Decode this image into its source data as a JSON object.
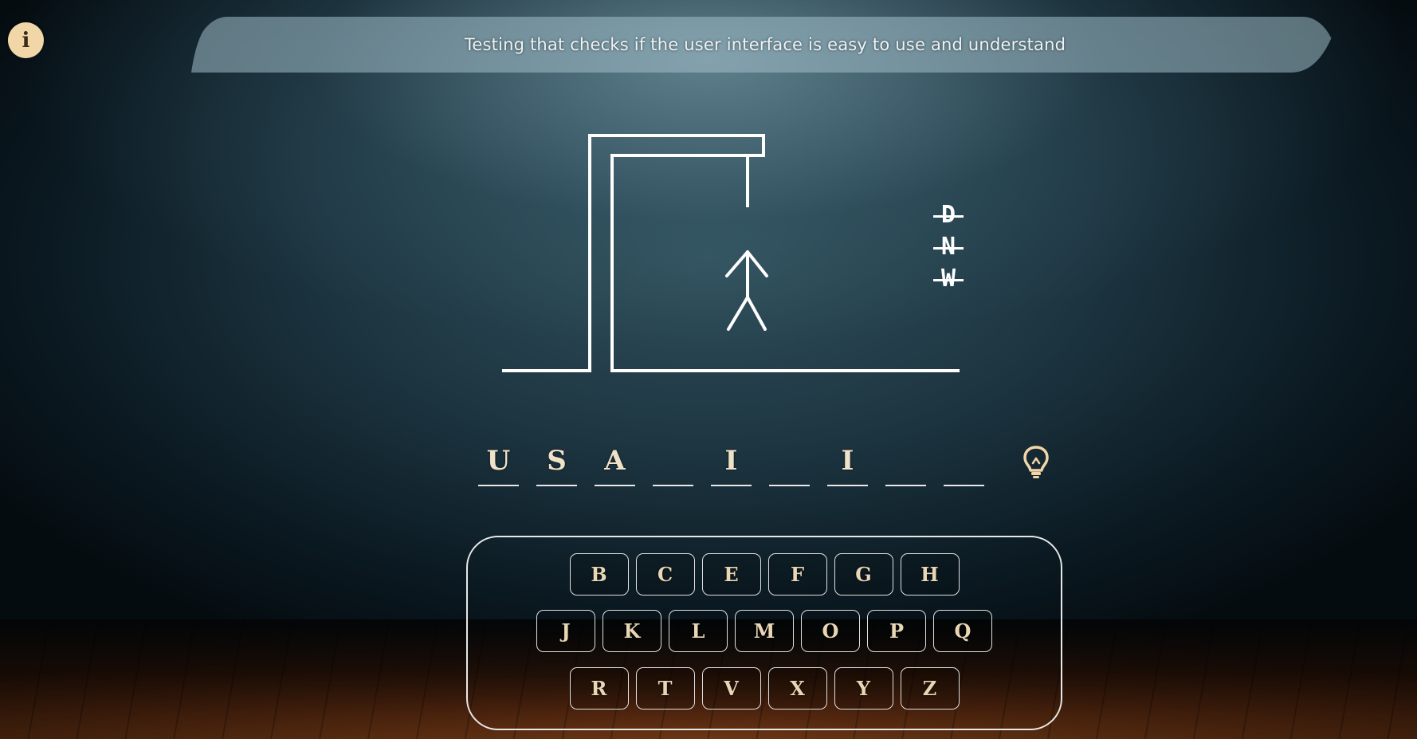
{
  "info": {
    "icon": "info-icon",
    "label": "i"
  },
  "banner": {
    "text": "Testing that checks if the user interface is easy to use and understand"
  },
  "missed_letters": [
    "D",
    "N",
    "W"
  ],
  "word": {
    "slots": [
      "U",
      "S",
      "A",
      "",
      "I",
      "",
      "I",
      "",
      ""
    ]
  },
  "hint": {
    "icon": "lightbulb-icon"
  },
  "keyboard": {
    "row1": [
      "B",
      "C",
      "E",
      "F",
      "G",
      "H"
    ],
    "row2": [
      "J",
      "K",
      "L",
      "M",
      "O",
      "P",
      "Q"
    ],
    "row3": [
      "R",
      "T",
      "V",
      "X",
      "Y",
      "Z"
    ]
  },
  "colors": {
    "chalk": "#ffffff",
    "info_bg": "#f1d6a8",
    "key_text": "#e8d6b4",
    "hint": "#f1d6a8"
  }
}
